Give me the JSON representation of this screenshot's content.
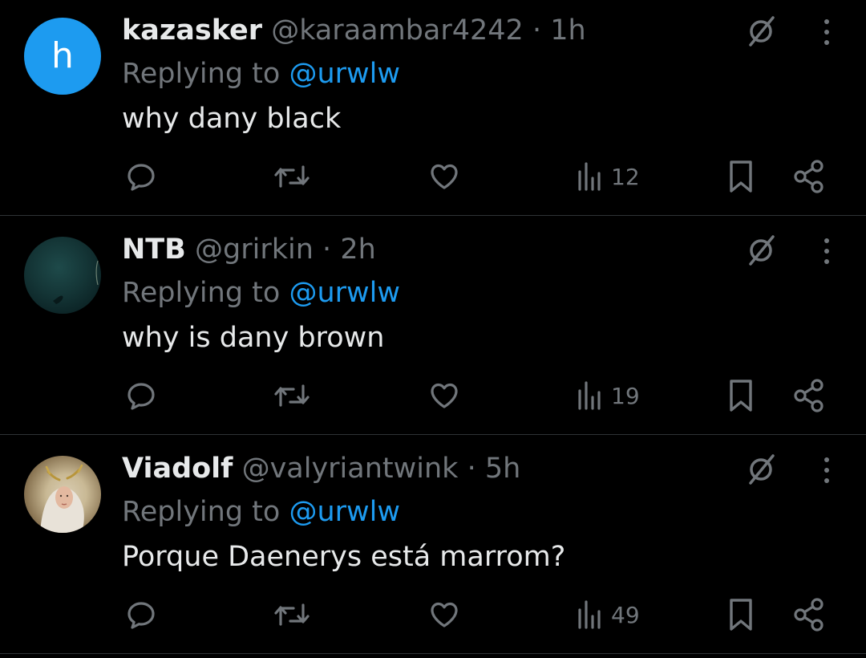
{
  "colors": {
    "background": "#000000",
    "text": "#e7e9ea",
    "muted": "#71767b",
    "accent": "#1d9bf0",
    "divider": "#2f3336"
  },
  "replies": [
    {
      "avatar_letter": "h",
      "display_name": "kazasker",
      "handle": "@karaambar4242",
      "separator": "·",
      "time": "1h",
      "replying_prefix": "Replying to",
      "replying_to": "@urwlw",
      "text": "why dany black",
      "views": "12"
    },
    {
      "avatar_letter": "",
      "display_name": "NTB",
      "handle": "@grirkin",
      "separator": "·",
      "time": "2h",
      "replying_prefix": "Replying to",
      "replying_to": "@urwlw",
      "text": "why is dany brown",
      "views": "19"
    },
    {
      "avatar_letter": "",
      "display_name": "Viadolf",
      "handle": "@valyriantwink",
      "separator": "·",
      "time": "5h",
      "replying_prefix": "Replying to",
      "replying_to": "@urwlw",
      "text": "Porque Daenerys está marrom?",
      "views": "49"
    }
  ],
  "icons": {
    "reply": "reply-icon",
    "retweet": "retweet-icon",
    "like": "heart-icon",
    "views": "views-icon",
    "bookmark": "bookmark-icon",
    "share": "share-icon",
    "grok": "grok-icon",
    "more": "more-icon"
  }
}
